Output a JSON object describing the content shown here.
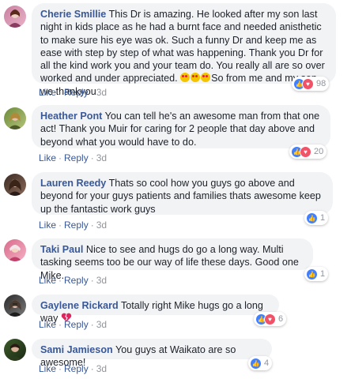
{
  "actions": {
    "like": "Like",
    "reply": "Reply",
    "sep": "·"
  },
  "comments": [
    {
      "author": "Cherie Smillie",
      "text": "This Dr is amazing. He looked after my son last night in kids place as he had a burnt face and needed anisthetic to make sure his eye was ok. Such a funny Dr and keep me as ease with step by step of what was happening. Thank you Dr for all the kind work you and your team do. You really all are so over worked and under appreciated.",
      "emoji_count": 3,
      "text_after_emoji": "So from me and my son we thankyou",
      "time": "3d",
      "reaction_count": "98",
      "reactions": [
        "like",
        "love"
      ]
    },
    {
      "author": "Heather Pont",
      "text": "You can tell he's an awesome man from that one act! Thank you Muir for caring for 2 people that day above and beyond what you would have to do.",
      "time": "3d",
      "reaction_count": "20",
      "reactions": [
        "like",
        "love"
      ]
    },
    {
      "author": "Lauren Reedy",
      "text": "Thats so cool how you guys go above and beyond for your guys patients and families thats awesome keep up the fantastic work guys",
      "time": "3d",
      "reaction_count": "1",
      "reactions": [
        "like"
      ]
    },
    {
      "author": "Taki Paul",
      "text": "Nice to see and hugs do go a long way. Multi tasking seems too be our way of life these days. Good one Mike.",
      "time": "3d",
      "reaction_count": "1",
      "reactions": [
        "like"
      ]
    },
    {
      "author": "Gaylene Rickard",
      "text": "Totally right Mike hugs go a long way",
      "time": "3d",
      "reaction_count": "6",
      "reactions": [
        "like",
        "love"
      ]
    },
    {
      "author": "Sami Jamieson",
      "text": "You guys at Waikato are so awesome!",
      "time": "3d",
      "reaction_count": "4",
      "reactions": [
        "like"
      ]
    }
  ]
}
